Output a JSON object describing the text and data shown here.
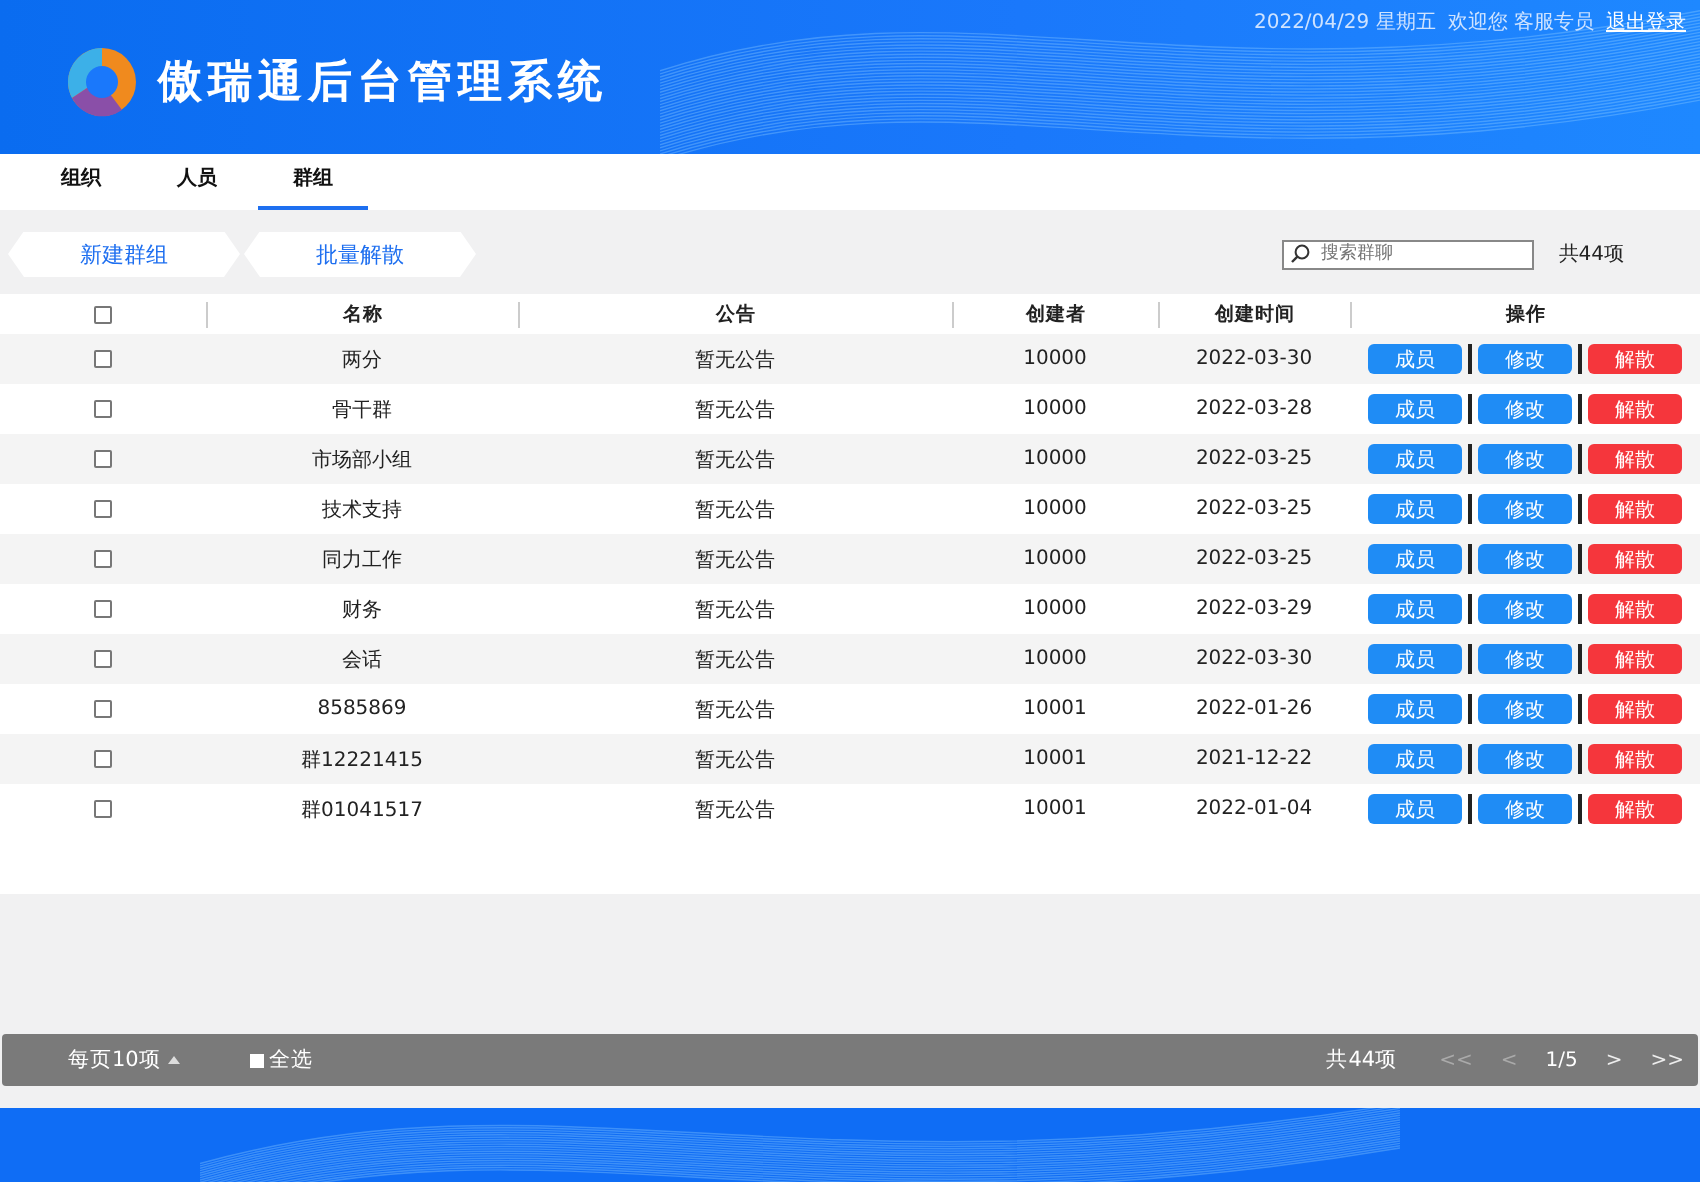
{
  "header": {
    "title": "傲瑞通后台管理系统",
    "date": "2022/04/29 星期五",
    "welcome": "欢迎您 客服专员",
    "logout": "退出登录"
  },
  "tabs": [
    {
      "label": "组织",
      "selected": false
    },
    {
      "label": "人员",
      "selected": false
    },
    {
      "label": "群组",
      "selected": true
    }
  ],
  "toolbar": {
    "buttons": [
      "新建群组",
      "批量解散"
    ],
    "search": {
      "placeholder": "搜索群聊"
    },
    "count": "共44项"
  },
  "table": {
    "select_all_checked": false,
    "columns": [
      "名称",
      "公告",
      "创建者",
      "创建时间",
      "操作"
    ],
    "rows": [
      {
        "checked": false,
        "name": "两分",
        "notice": "暂无公告",
        "creator": "10000",
        "created": "2022-03-30",
        "actions": [
          "成员",
          "修改",
          "解散"
        ]
      },
      {
        "checked": false,
        "name": "骨干群",
        "notice": "暂无公告",
        "creator": "10000",
        "created": "2022-03-28",
        "actions": [
          "成员",
          "修改",
          "解散"
        ]
      },
      {
        "checked": false,
        "name": "市场部小组",
        "notice": "暂无公告",
        "creator": "10000",
        "created": "2022-03-25",
        "actions": [
          "成员",
          "修改",
          "解散"
        ]
      },
      {
        "checked": false,
        "name": "技术支持",
        "notice": "暂无公告",
        "creator": "10000",
        "created": "2022-03-25",
        "actions": [
          "成员",
          "修改",
          "解散"
        ]
      },
      {
        "checked": false,
        "name": "同力工作",
        "notice": "暂无公告",
        "creator": "10000",
        "created": "2022-03-25",
        "actions": [
          "成员",
          "修改",
          "解散"
        ]
      },
      {
        "checked": false,
        "name": "财务",
        "notice": "暂无公告",
        "creator": "10000",
        "created": "2022-03-29",
        "actions": [
          "成员",
          "修改",
          "解散"
        ]
      },
      {
        "checked": false,
        "name": "会话",
        "notice": "暂无公告",
        "creator": "10000",
        "created": "2022-03-30",
        "actions": [
          "成员",
          "修改",
          "解散"
        ]
      },
      {
        "checked": false,
        "name": "8585869",
        "notice": "暂无公告",
        "creator": "10001",
        "created": "2022-01-26",
        "actions": [
          "成员",
          "修改",
          "解散"
        ]
      },
      {
        "checked": false,
        "name": "群12221415",
        "notice": "暂无公告",
        "creator": "10001",
        "created": "2021-12-22",
        "actions": [
          "成员",
          "修改",
          "解散"
        ]
      },
      {
        "checked": false,
        "name": "群01041517",
        "notice": "暂无公告",
        "creator": "10001",
        "created": "2022-01-04",
        "actions": [
          "成员",
          "修改",
          "解散"
        ]
      }
    ]
  },
  "footer": {
    "page_size": "每页10项",
    "select_all": {
      "label": "全选",
      "checked": false
    },
    "total": "共44项",
    "pager": [
      {
        "kind": "button",
        "label": "<<",
        "disabled": true
      },
      {
        "kind": "button",
        "label": "<",
        "disabled": true
      },
      {
        "kind": "page",
        "label": "1/5"
      },
      {
        "kind": "button",
        "label": ">",
        "disabled": false
      },
      {
        "kind": "button",
        "label": ">>",
        "disabled": false
      }
    ]
  }
}
